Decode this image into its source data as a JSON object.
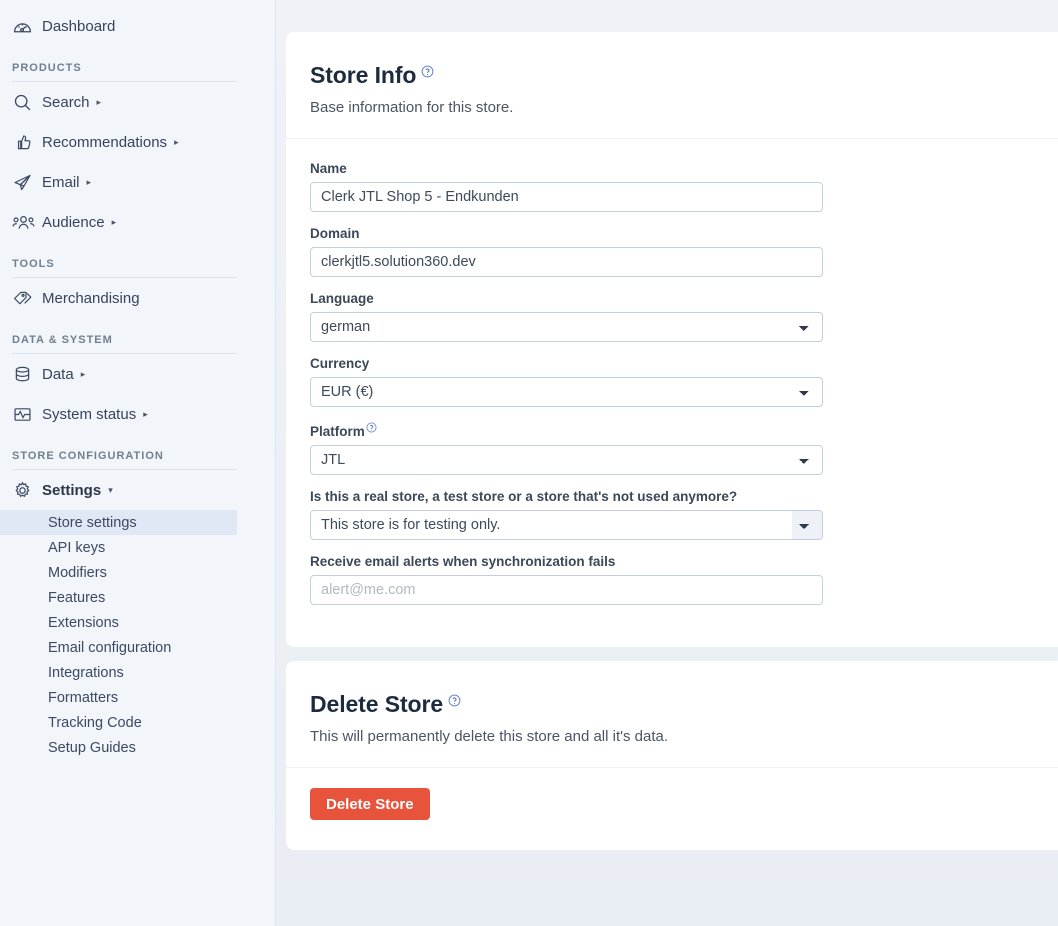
{
  "sidebar": {
    "dashboard": {
      "label": "Dashboard",
      "icon": "gauge-icon"
    },
    "sections": [
      {
        "title": "PRODUCTS",
        "items": [
          {
            "label": "Search",
            "icon": "magnifier-icon",
            "caret": "▸"
          },
          {
            "label": "Recommendations",
            "icon": "thumbs-up-icon",
            "caret": "▸"
          },
          {
            "label": "Email",
            "icon": "paper-plane-icon",
            "caret": "▸"
          },
          {
            "label": "Audience",
            "icon": "people-icon",
            "caret": "▸"
          }
        ]
      },
      {
        "title": "TOOLS",
        "items": [
          {
            "label": "Merchandising",
            "icon": "price-tag-icon",
            "caret": ""
          }
        ]
      },
      {
        "title": "DATA & SYSTEM",
        "items": [
          {
            "label": "Data",
            "icon": "database-icon",
            "caret": "▸"
          },
          {
            "label": "System status",
            "icon": "pulse-icon",
            "caret": "▸"
          }
        ]
      },
      {
        "title": "STORE CONFIGURATION",
        "items": [
          {
            "label": "Settings",
            "icon": "gear-icon",
            "caret": "▾"
          }
        ]
      }
    ],
    "settings_subitems": [
      {
        "label": "Store settings",
        "active": true
      },
      {
        "label": "API keys",
        "active": false
      },
      {
        "label": "Modifiers",
        "active": false
      },
      {
        "label": "Features",
        "active": false
      },
      {
        "label": "Extensions",
        "active": false
      },
      {
        "label": "Email configuration",
        "active": false
      },
      {
        "label": "Integrations",
        "active": false
      },
      {
        "label": "Formatters",
        "active": false
      },
      {
        "label": "Tracking Code",
        "active": false
      },
      {
        "label": "Setup Guides",
        "active": false
      }
    ]
  },
  "store_info": {
    "title": "Store Info",
    "help_icon": "question-circle-icon",
    "subtitle": "Base information for this store.",
    "fields": {
      "name": {
        "label": "Name",
        "value": "Clerk JTL Shop 5 - Endkunden"
      },
      "domain": {
        "label": "Domain",
        "value": "clerkjtl5.solution360.dev"
      },
      "language": {
        "label": "Language",
        "value": "german"
      },
      "currency": {
        "label": "Currency",
        "value": "EUR (€)"
      },
      "platform": {
        "label": "Platform",
        "value": "JTL",
        "help_icon": "question-circle-icon"
      },
      "store_type": {
        "label": "Is this a real store, a test store or a store that's not used anymore?",
        "value": "This store is for testing only."
      },
      "email_alerts": {
        "label": "Receive email alerts when synchronization fails",
        "value": "",
        "placeholder": "alert@me.com"
      }
    }
  },
  "delete_store": {
    "title": "Delete Store",
    "help_icon": "question-circle-icon",
    "subtitle": "This will permanently delete this store and all it's data.",
    "button_label": "Delete Store",
    "button_color": "#e8533c"
  }
}
